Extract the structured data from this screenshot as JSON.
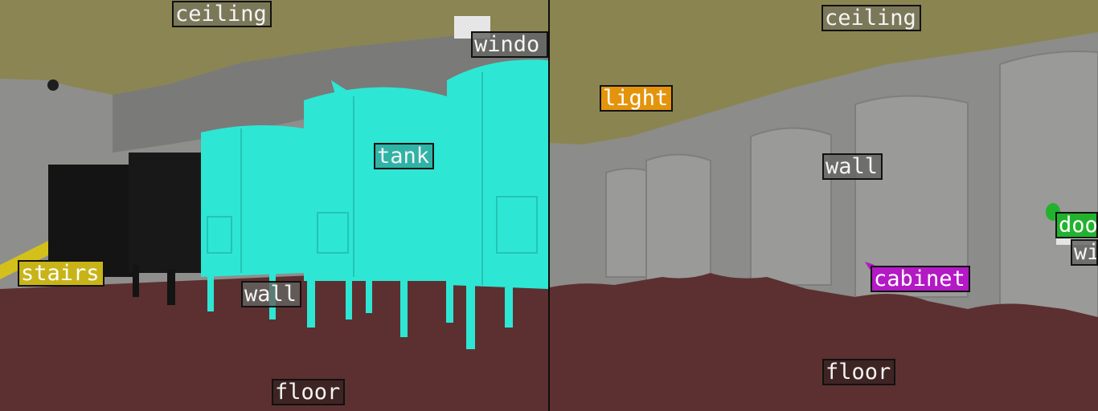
{
  "left_panel": {
    "labels": {
      "ceiling": "ceiling",
      "window": "windo",
      "tank": "tank",
      "stairs": "stairs",
      "wall": "wall",
      "floor": "floor"
    }
  },
  "right_panel": {
    "labels": {
      "ceiling": "ceiling",
      "light": "light",
      "wall": "wall",
      "door": "doo",
      "window_partial": "wi",
      "cabinet": "cabinet",
      "floor": "floor"
    }
  },
  "colors": {
    "ceiling": "#8a8550",
    "wall": "#8c8c8a",
    "floor": "#5c3030",
    "tank": "#2ee6d4",
    "stairs": "#d4c01a",
    "light": "#e4940c",
    "cabinet": "#b319c4",
    "door": "#22b22e"
  }
}
